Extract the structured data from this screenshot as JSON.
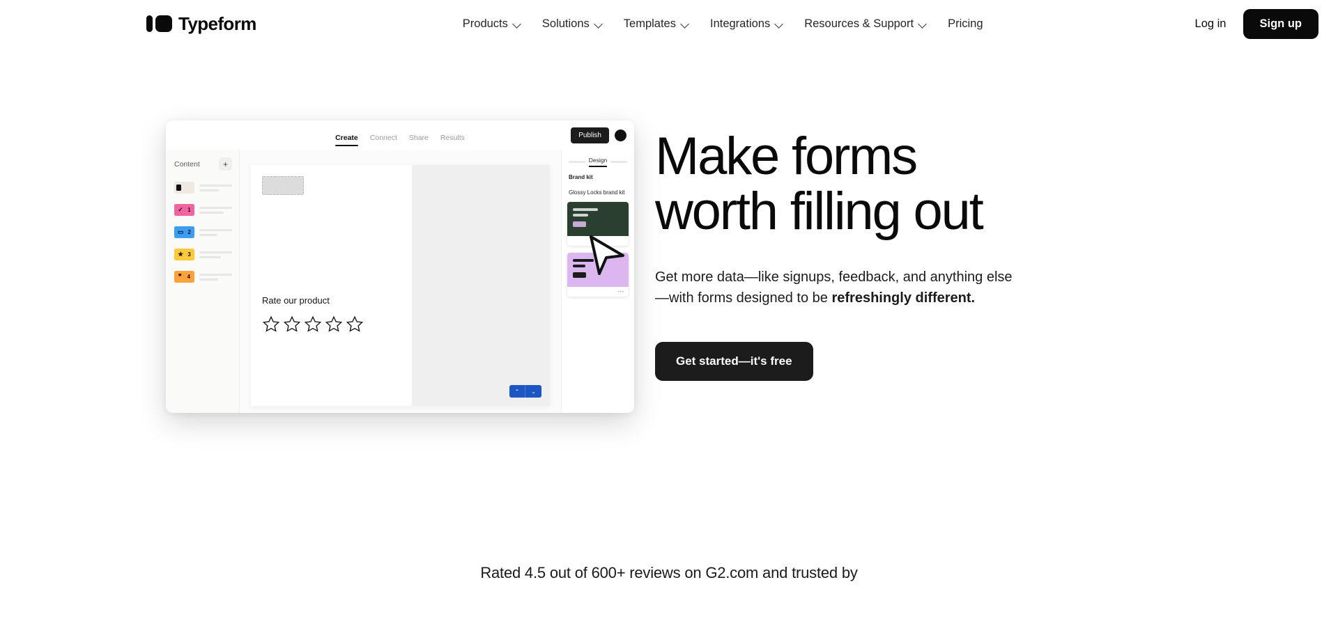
{
  "header": {
    "brand_name": "Typeform",
    "nav_items": [
      {
        "label": "Products",
        "has_chevron": true
      },
      {
        "label": "Solutions",
        "has_chevron": true
      },
      {
        "label": "Templates",
        "has_chevron": true
      },
      {
        "label": "Integrations",
        "has_chevron": true
      },
      {
        "label": "Resources & Support",
        "has_chevron": true
      },
      {
        "label": "Pricing",
        "has_chevron": false
      }
    ],
    "login_label": "Log in",
    "signup_label": "Sign up"
  },
  "hero": {
    "headline_line1": "Make forms",
    "headline_line2": "worth filling out",
    "subtitle_normal": "Get more data—like signups, feedback, and anything else—with forms designed to be ",
    "subtitle_bold": "refreshingly different.",
    "cta_label": "Get started—it's free"
  },
  "mockup": {
    "tabs": [
      {
        "label": "Create",
        "active": true
      },
      {
        "label": "Connect",
        "active": false
      },
      {
        "label": "Share",
        "active": false
      },
      {
        "label": "Results",
        "active": false
      }
    ],
    "publish_label": "Publish",
    "sidebar": {
      "title": "Content",
      "add_label": "+",
      "questions": [
        {
          "glyph": "",
          "number": "",
          "color": "#efe9e1",
          "thumb": true
        },
        {
          "glyph": "✓",
          "number": "1",
          "color": "#f2649f"
        },
        {
          "glyph": "▭",
          "number": "2",
          "color": "#3b9ef5"
        },
        {
          "glyph": "★",
          "number": "3",
          "color": "#ffc93c"
        },
        {
          "glyph": "❞",
          "number": "4",
          "color": "#ffa23c"
        }
      ]
    },
    "canvas": {
      "question_label": "Rate our product",
      "star_count": 5,
      "nav_up": "⌃",
      "nav_down": "⌄"
    },
    "design_panel": {
      "tab_label": "Design",
      "section_title": "Brand kit",
      "kit_name": "Glossy Locks brand kit",
      "kit_footer_dots": "•••"
    }
  },
  "footer": {
    "rated_text": "Rated 4.5 out of 600+ reviews on G2.com and trusted by"
  },
  "colors": {
    "accent_black": "#0a0a0a",
    "canvas_blue": "#1b56c4",
    "brand_dark_green": "#2b3f31",
    "brand_lavender": "#dcb7ef"
  }
}
